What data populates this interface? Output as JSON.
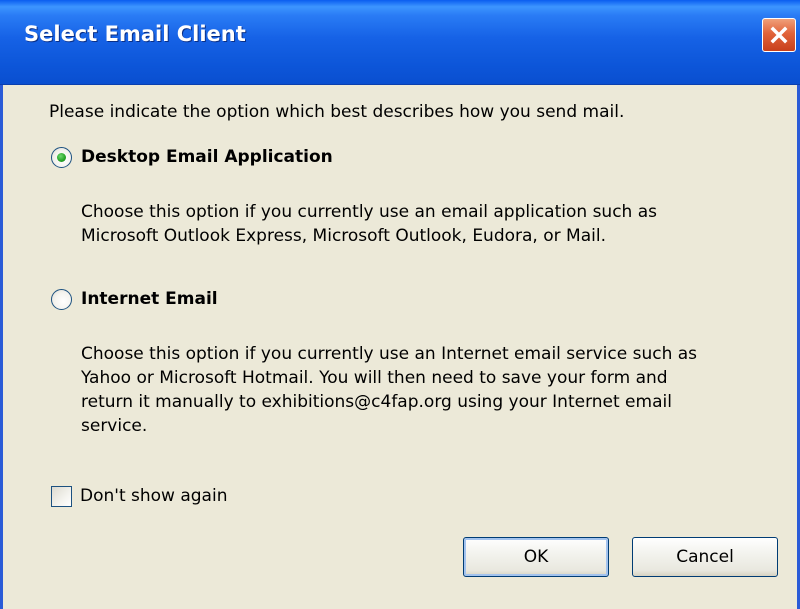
{
  "dialog": {
    "title": "Select Email Client",
    "prompt": "Please indicate the option which best describes how you send mail.",
    "options": [
      {
        "label": "Desktop Email Application",
        "selected": true,
        "description_lines": [
          "Choose this option if you currently use an email application such as",
          "Microsoft Outlook Express, Microsoft Outlook, Eudora, or Mail."
        ]
      },
      {
        "label": "Internet Email",
        "selected": false,
        "description_lines": [
          "Choose this option if you currently use an Internet email service such as",
          "Yahoo or Microsoft Hotmail. You will then need to save your form and",
          "return it manually to exhibitions@c4fap.org using your Internet email",
          "service."
        ]
      }
    ],
    "dont_show_again": {
      "label": "Don't show again",
      "checked": false
    },
    "buttons": {
      "ok": "OK",
      "cancel": "Cancel"
    }
  },
  "colors": {
    "title_bar": "#1662e6",
    "close_button": "#e1633a",
    "dialog_background": "#ece9d8",
    "selected_radio_dot": "#2aa82a"
  },
  "icons": {
    "close": "close-x-icon"
  }
}
